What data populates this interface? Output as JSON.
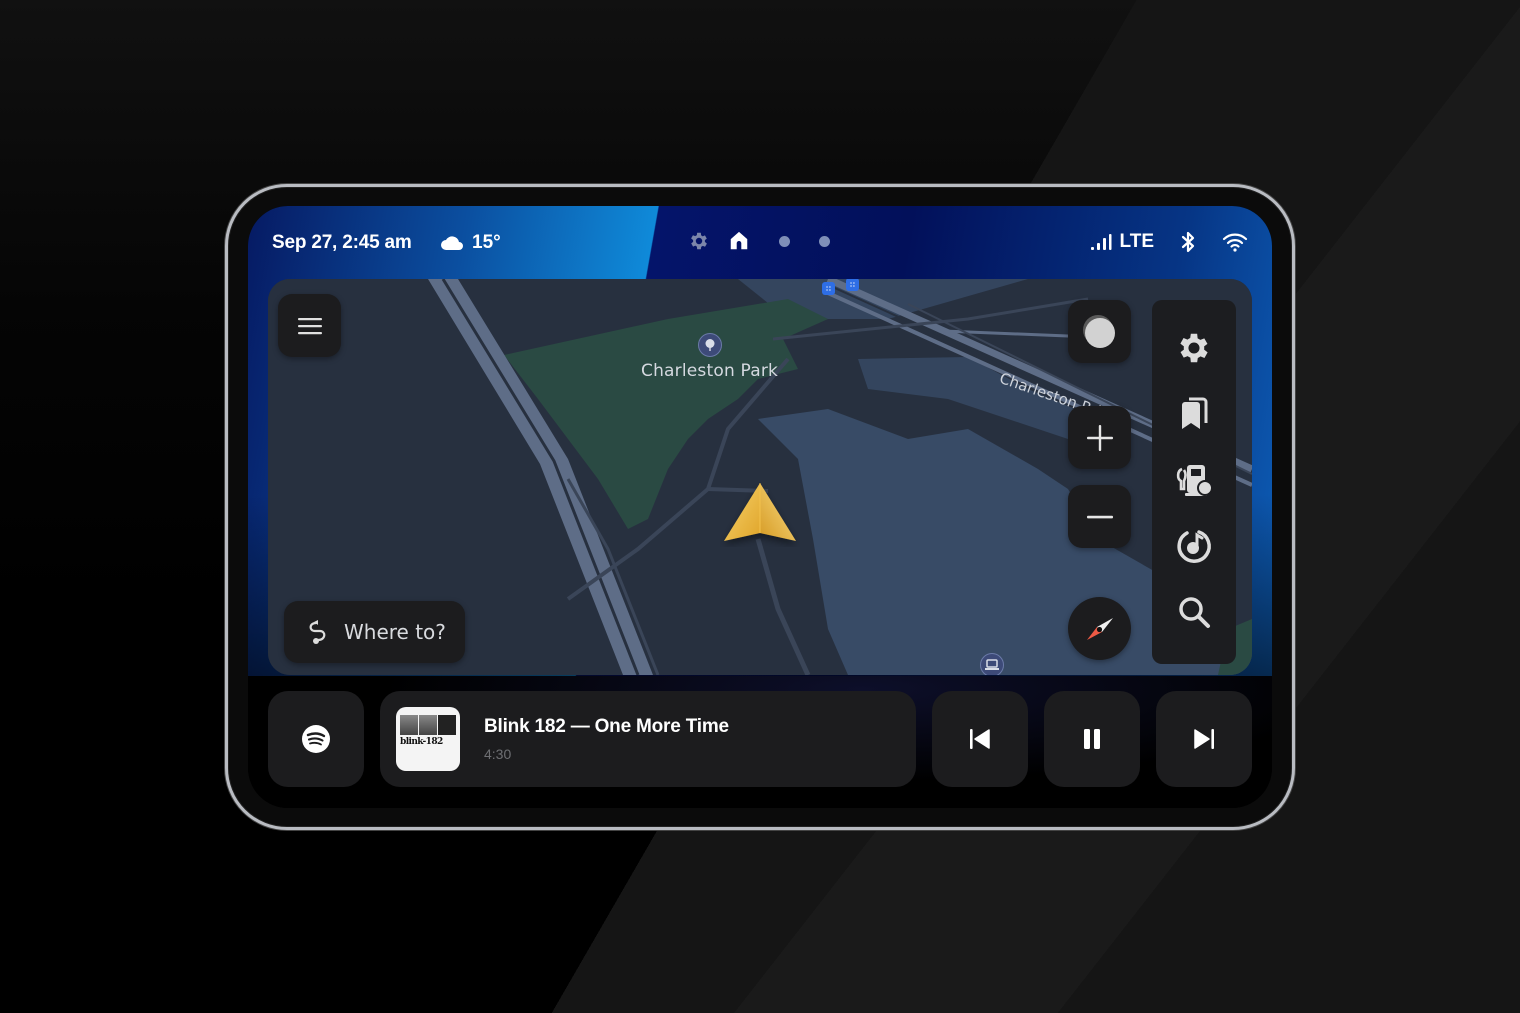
{
  "status_bar": {
    "datetime": "Sep 27, 2:45 am",
    "weather_icon": "cloud-icon",
    "temperature": "15°",
    "pages": [
      {
        "icon": "gear-icon",
        "active": false
      },
      {
        "icon": "home-icon",
        "active": true
      },
      {
        "icon": "page-dot",
        "active": false
      },
      {
        "icon": "page-dot",
        "active": false
      }
    ],
    "signal_icon": "cellular-signal-icon",
    "network": "LTE",
    "bluetooth_icon": "bluetooth-icon",
    "wifi_icon": "wifi-icon"
  },
  "map": {
    "park_label": "Charleston Park",
    "road_label": "Charleston Rd",
    "transit_badges": [
      "∷",
      "∷"
    ],
    "menu_icon": "hamburger-menu-icon",
    "theme_icon": "day-night-toggle-icon",
    "zoom_in_icon": "plus-icon",
    "zoom_out_icon": "minus-icon",
    "compass_icon": "compass-icon",
    "where_to": {
      "icon": "route-icon",
      "label": "Where to?"
    },
    "navigation_marker": "navigation-arrow-icon"
  },
  "side_rail": {
    "items": [
      {
        "icon": "settings-gear-icon",
        "name": "settings"
      },
      {
        "icon": "bookmarks-icon",
        "name": "saved-places"
      },
      {
        "icon": "ev-charging-station-icon",
        "name": "charging-stations"
      },
      {
        "icon": "music-player-icon",
        "name": "media"
      },
      {
        "icon": "search-icon",
        "name": "search"
      }
    ]
  },
  "media": {
    "source_icon": "spotify-icon",
    "track_title": "Blink 182 — One More Time",
    "duration": "4:30",
    "album_art_text": "blink-182",
    "controls": {
      "previous_icon": "skip-previous-icon",
      "pause_icon": "pause-icon",
      "next_icon": "skip-next-icon"
    }
  }
}
